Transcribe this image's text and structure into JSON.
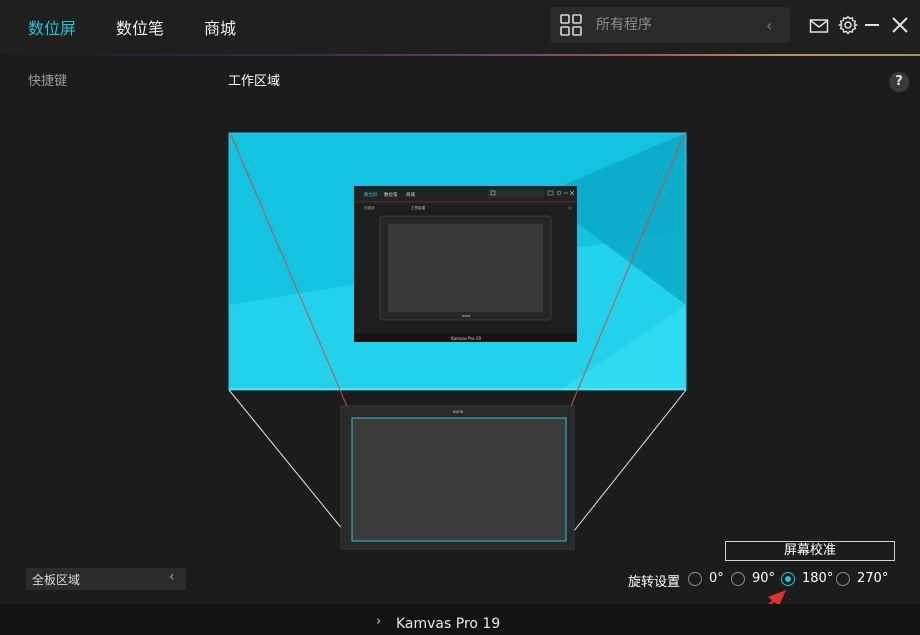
{
  "tabs": [
    {
      "label": "数位屏",
      "active": true
    },
    {
      "label": "数位笔",
      "active": false
    },
    {
      "label": "商城",
      "active": false
    }
  ],
  "search": {
    "placeholder": "所有程序",
    "icon": "grid-icon",
    "arrow": "‹"
  },
  "window_icons": [
    "mail-icon",
    "gear-icon",
    "minimize-icon",
    "close-icon"
  ],
  "sidebar": {
    "shortcut_label": "快捷键"
  },
  "workarea": {
    "title": "工作区域",
    "help": "?",
    "thumbnail": {
      "tabs": [
        "数位屏",
        "数位笔",
        "商城"
      ],
      "sub_left": "快捷键",
      "sub_title": "工作区域",
      "brand": "HUION",
      "device": "Kamvas Pro 19"
    },
    "tablet_brand": "HUION"
  },
  "calibrate_label": "屏幕校准",
  "area_select": {
    "value": "全板区域",
    "arrow": "‹"
  },
  "rotation": {
    "label": "旋转设置",
    "options": [
      {
        "label": "0°",
        "checked": false
      },
      {
        "label": "90°",
        "checked": false
      },
      {
        "label": "180°",
        "checked": true
      },
      {
        "label": "270°",
        "checked": false
      }
    ]
  },
  "device": {
    "chevron": "›",
    "name": "Kamvas Pro 19"
  },
  "colors": {
    "accent": "#2bc1d6",
    "background": "#1c1c1c",
    "screen_cyan": "#16c8e2",
    "arrow_red": "#e03030"
  }
}
